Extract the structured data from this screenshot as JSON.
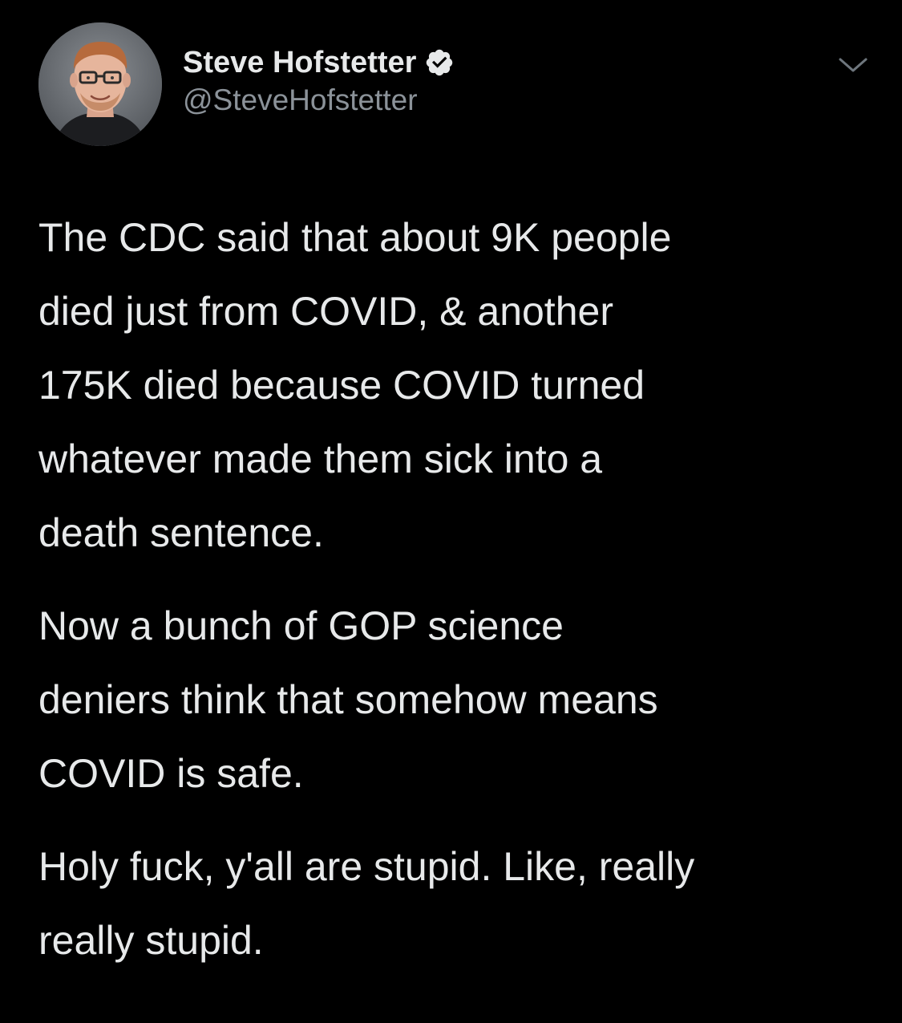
{
  "tweet": {
    "author": {
      "display_name": "Steve Hofstetter",
      "handle": "@SteveHofstetter",
      "verified": true,
      "avatar_icon": "profile-photo",
      "verified_icon": "verified-badge-icon"
    },
    "menu_icon": "chevron-down-icon",
    "paragraphs": [
      "The CDC said that about 9K people\ndied just from COVID, & another\n175K died because COVID turned\nwhatever made them sick into a\ndeath sentence.",
      "Now a bunch of GOP science\ndeniers think that somehow means\nCOVID is safe.",
      "Holy fuck, y'all are stupid. Like, really\nreally stupid."
    ]
  },
  "colors": {
    "background": "#000000",
    "text": "#e7e9ea",
    "secondary_text": "#8b9299",
    "verified_badge": "#e7e9ea"
  }
}
